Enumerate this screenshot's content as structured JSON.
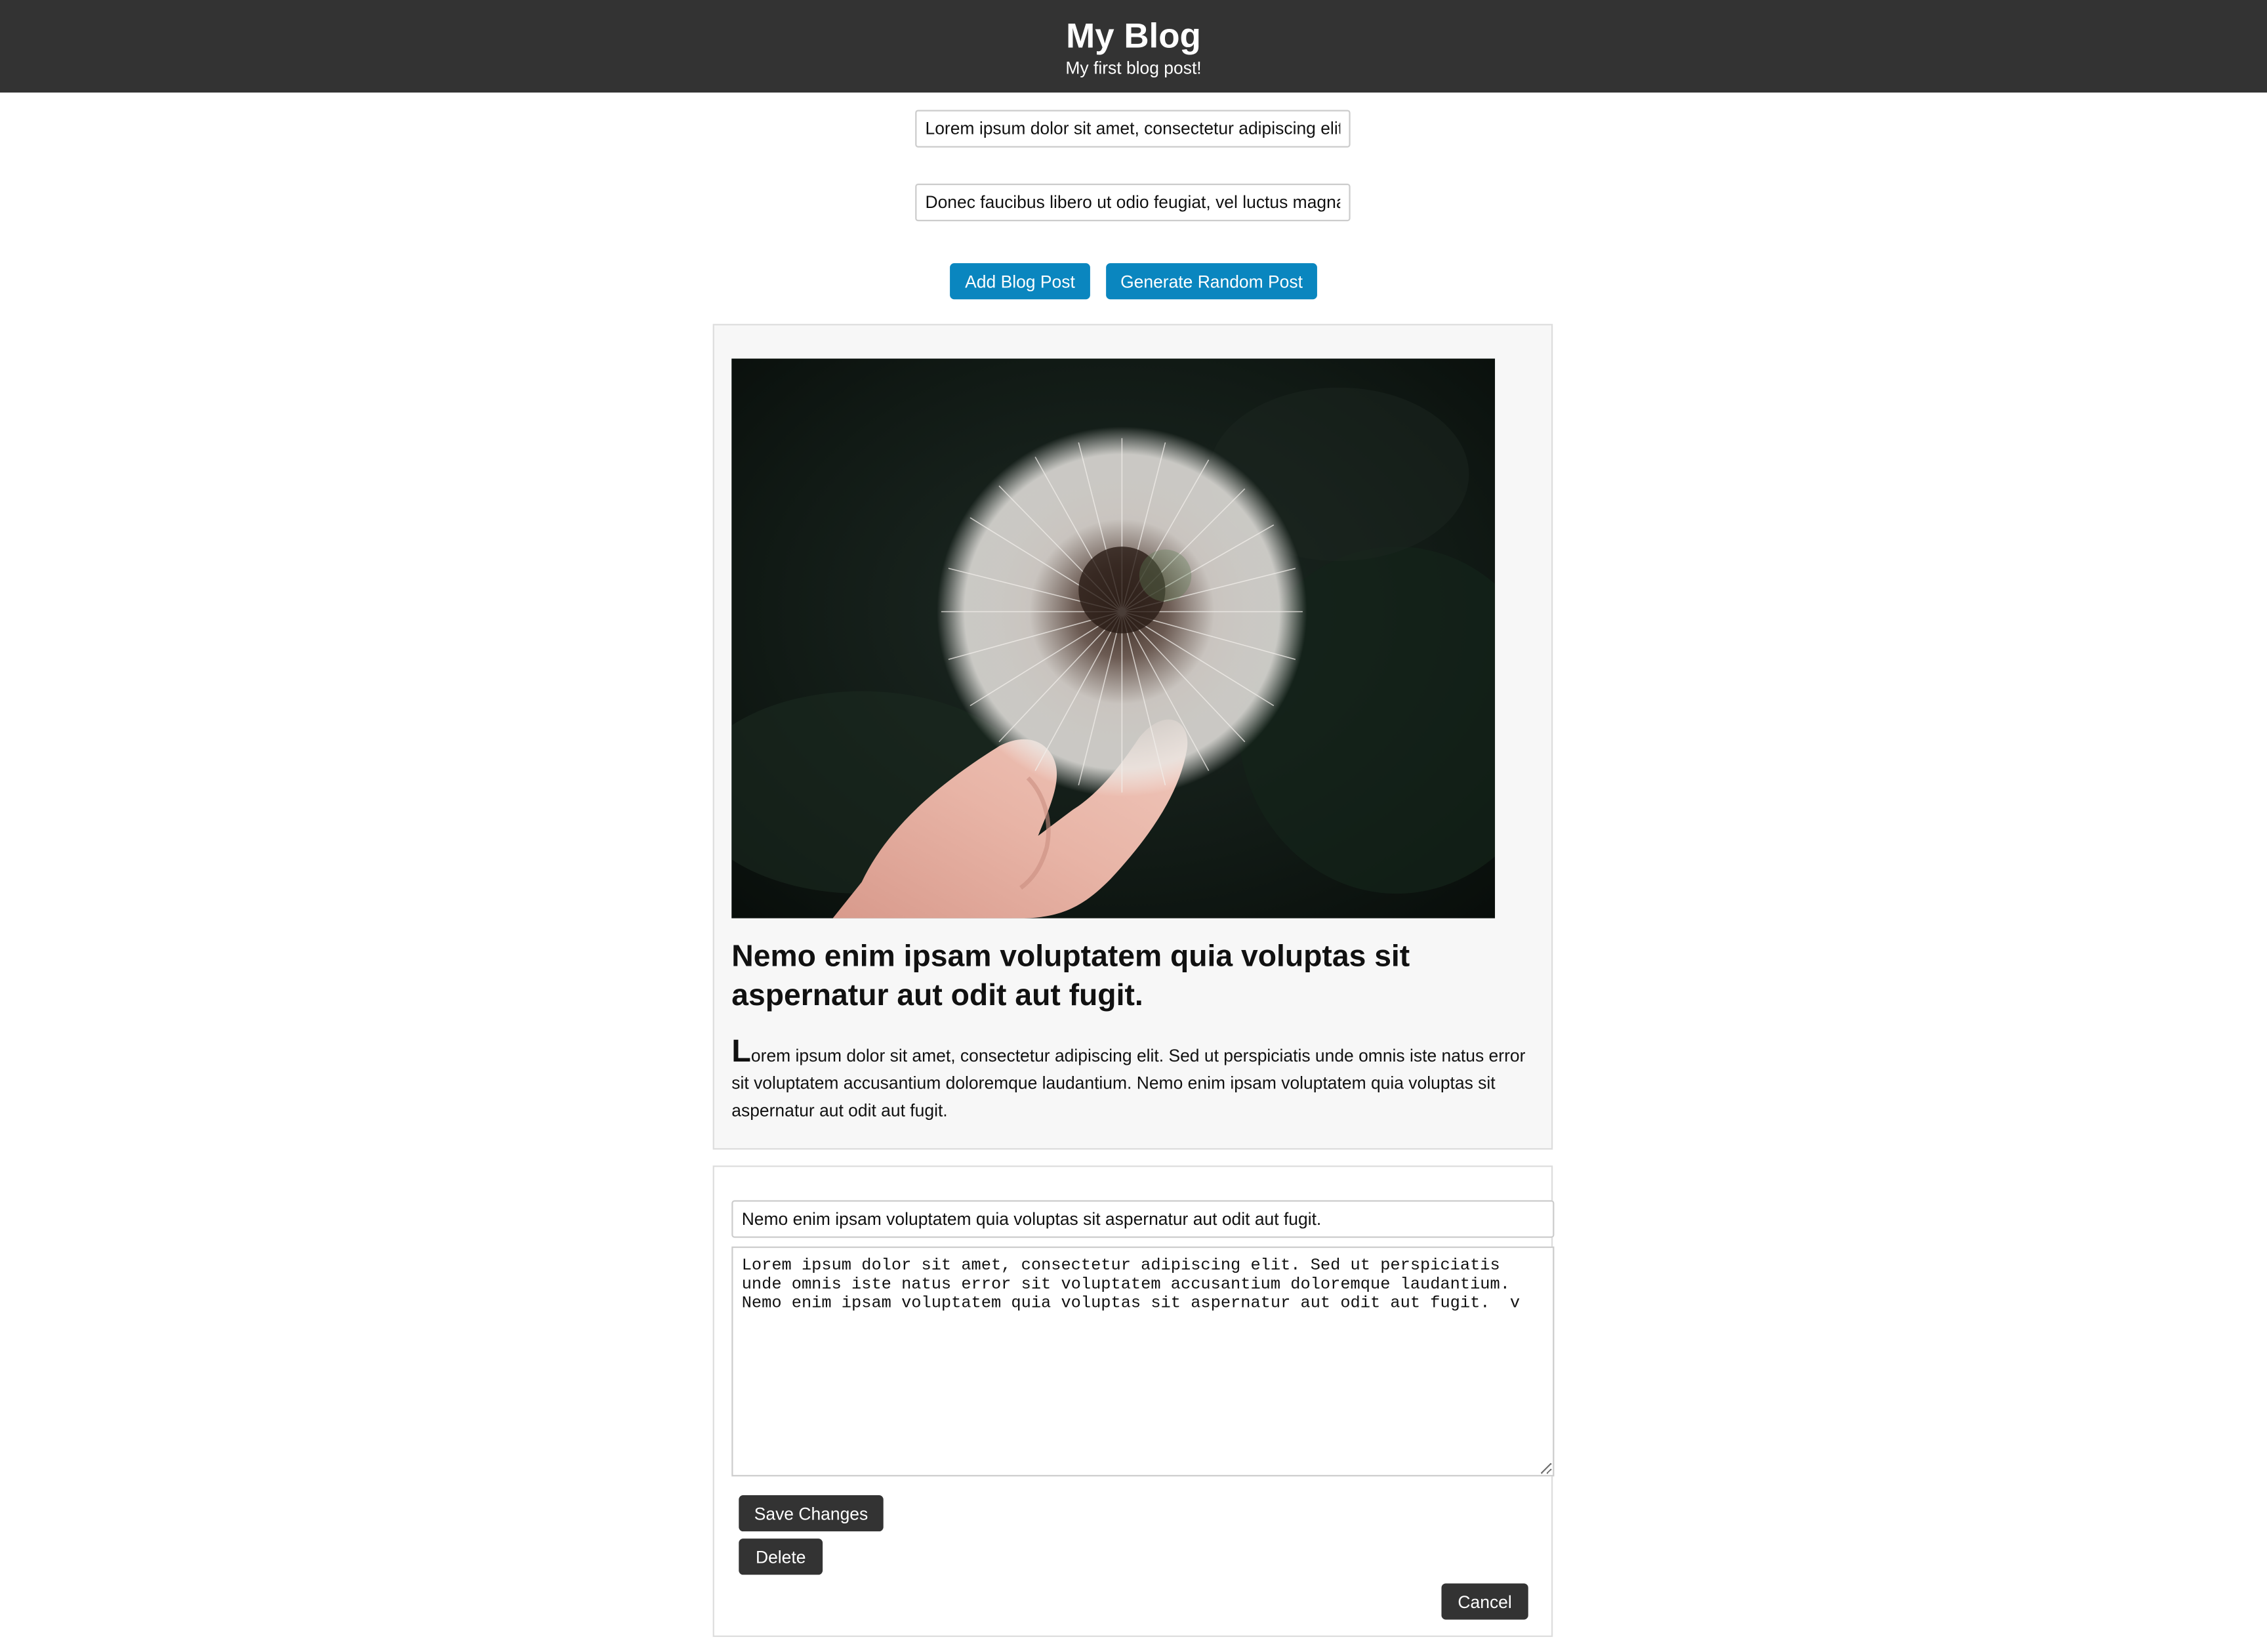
{
  "header": {
    "title": "My Blog",
    "subtitle": "My first blog post!"
  },
  "form": {
    "title_value": "Lorem ipsum dolor sit amet, consectetur adipiscing elit. Sed ut perspiciatis",
    "content_value": "Donec faucibus libero ut odio feugiat, vel luctus magna fermentum.",
    "add_button": "Add Blog Post",
    "random_button": "Generate Random Post"
  },
  "post": {
    "image_subject": "dandelion-seed-head-photo",
    "title": "Nemo enim ipsam voluptatem quia voluptas sit aspernatur aut odit aut fugit.",
    "body_first_letter": "L",
    "body_rest": "orem ipsum dolor sit amet, consectetur adipiscing elit. Sed ut perspiciatis unde omnis iste natus error sit voluptatem accusantium doloremque laudantium. Nemo enim ipsam voluptatem quia voluptas sit aspernatur aut odit aut fugit."
  },
  "editor": {
    "title_value": "Nemo enim ipsam voluptatem quia voluptas sit aspernatur aut odit aut fugit.",
    "content_value": "Lorem ipsum dolor sit amet, consectetur adipiscing elit. Sed ut perspiciatis unde omnis iste natus error sit voluptatem accusantium doloremque laudantium. Nemo enim ipsam voluptatem quia voluptas sit aspernatur aut odit aut fugit.  v",
    "save_button": "Save Changes",
    "delete_button": "Delete",
    "cancel_button": "Cancel"
  },
  "colors": {
    "header_bg": "#333333",
    "primary_button": "#0a86bf",
    "dark_button": "#333333",
    "card_bg": "#f7f7f7"
  }
}
